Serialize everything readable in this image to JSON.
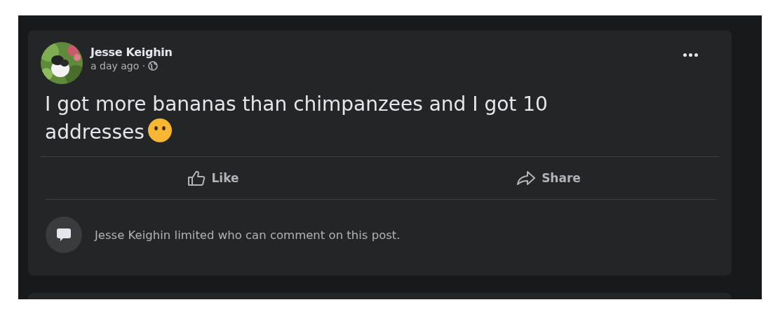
{
  "post": {
    "author": "Jesse Keighin",
    "meta": [
      {
        "kind": "time",
        "text": "a day ago ·"
      },
      {
        "kind": "public-icon"
      }
    ],
    "body": [
      {
        "kind": "text",
        "text": "I got more bananas than chimpanzees and I got 10 addresses"
      },
      {
        "kind": "no-mouth-emoji"
      }
    ],
    "actions": [
      {
        "kind": "like",
        "label": "Like"
      },
      {
        "kind": "share",
        "label": "Share"
      }
    ],
    "notice": "Jesse Keighin limited who can comment on this post."
  }
}
